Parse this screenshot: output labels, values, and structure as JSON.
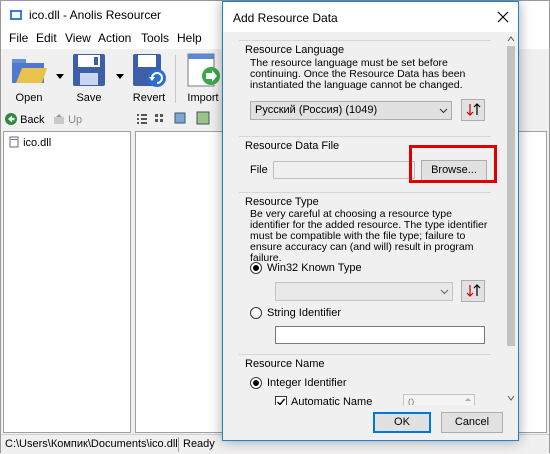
{
  "app": {
    "title": "ico.dll - Anolis Resourcer",
    "menu": [
      "File",
      "Edit",
      "View",
      "Action",
      "Tools",
      "Help"
    ],
    "toolbar": {
      "open": "Open",
      "save": "Save",
      "revert": "Revert",
      "import": "Import"
    },
    "nav": {
      "back": "Back",
      "up": "Up"
    },
    "tree": {
      "item": "ico.dll"
    },
    "status": {
      "path": "C:\\Users\\Компик\\Documents\\ico.dll",
      "state": "Ready"
    }
  },
  "dialog": {
    "title": "Add Resource Data",
    "language": {
      "heading": "Resource Language",
      "note": "The resource language must be set before continuing. Once the Resource Data has been instantiated the language cannot be changed.",
      "selected": "Русский (Россия) (1049)"
    },
    "file": {
      "heading": "Resource Data File",
      "label": "File",
      "value": "",
      "browse": "Browse..."
    },
    "type": {
      "heading": "Resource Type",
      "note": "Be very careful at choosing a resource type identifier for the added resource. The type identifier must be compatible with the file type; failure to ensure accuracy can (and will) result in program failure.",
      "win32_label": "Win32 Known Type",
      "win32_selected": "",
      "string_label": "String Identifier",
      "string_value": ""
    },
    "name": {
      "heading": "Resource Name",
      "integer_label": "Integer Identifier",
      "auto_label": "Automatic Name",
      "spin_value": "0"
    },
    "ok": "OK",
    "cancel": "Cancel"
  },
  "colors": {
    "accent": "#0078d7",
    "highlight": "#e00000"
  }
}
